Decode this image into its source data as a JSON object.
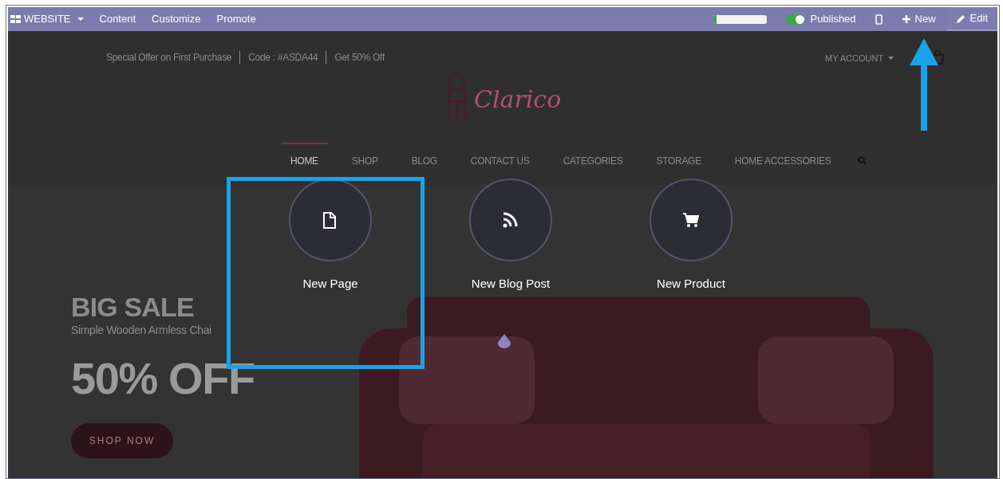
{
  "toolbar": {
    "menus": [
      {
        "label": "WEBSITE",
        "kind": "apps"
      },
      {
        "label": "Content",
        "kind": "plain"
      },
      {
        "label": "Customize",
        "kind": "plain"
      },
      {
        "label": "Promote",
        "kind": "plain"
      }
    ],
    "progress": {
      "level": 0.05
    },
    "publish": {
      "label": "Published",
      "on": true
    },
    "new_button": {
      "label": "New"
    },
    "edit_button": {
      "label": "Edit"
    }
  },
  "header": {
    "promo": [
      "Special Offer on First Purchase",
      "Code : #ASDA44",
      "Get 50% Off"
    ],
    "account": "MY ACCOUNT",
    "logo": "Clarico",
    "nav": [
      {
        "label": "HOME",
        "selected": true
      },
      {
        "label": "SHOP",
        "selected": false
      },
      {
        "label": "BLOG",
        "selected": false
      },
      {
        "label": "CONTACT US",
        "selected": false
      },
      {
        "label": "CATEGORIES",
        "selected": false
      },
      {
        "label": "STORAGE",
        "selected": false
      },
      {
        "label": "HOME ACCESSORIES",
        "selected": false
      }
    ]
  },
  "hero": {
    "title": "BIG SALE",
    "subtitle": "Simple Wooden Armless Chai",
    "discount": "50% OFF",
    "button": "SHOP NOW"
  },
  "new_menu": {
    "options": [
      {
        "kind": "page",
        "label": "New Page",
        "highlighted": true
      },
      {
        "kind": "blog",
        "label": "New Blog Post",
        "highlighted": false
      },
      {
        "kind": "product",
        "label": "New Product",
        "highlighted": false
      }
    ]
  }
}
